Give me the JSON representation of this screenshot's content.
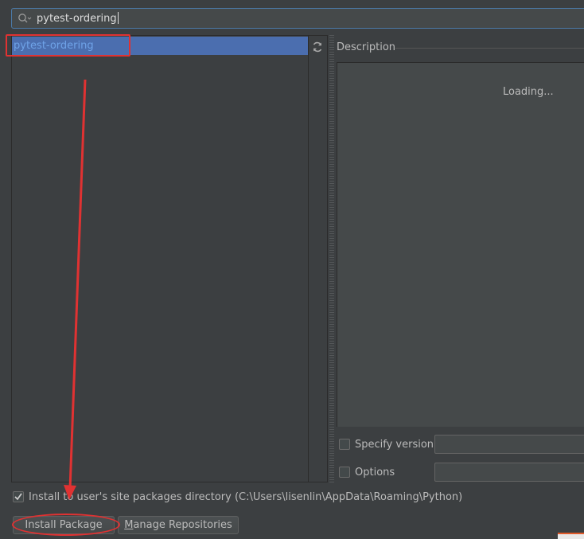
{
  "search": {
    "value": "pytest-ordering"
  },
  "package_list": {
    "items": [
      {
        "label": "pytest-ordering",
        "selected": true
      }
    ]
  },
  "description": {
    "label": "Description",
    "status": "Loading..."
  },
  "specify_version": {
    "label": "Specify version",
    "checked": false,
    "value": ""
  },
  "options": {
    "label": "Options",
    "checked": false,
    "value": ""
  },
  "install_to_user": {
    "label": "Install to user's site packages directory (C:\\Users\\lisenlin\\AppData\\Roaming\\Python)",
    "checked": true
  },
  "buttons": {
    "install": "Install Package",
    "manage_prefix": "",
    "manage_mnemonic": "M",
    "manage_rest": "anage Repositories"
  },
  "colors": {
    "selection": "#4b6eaf",
    "annotation": "#e03232",
    "background": "#3c3f41"
  }
}
